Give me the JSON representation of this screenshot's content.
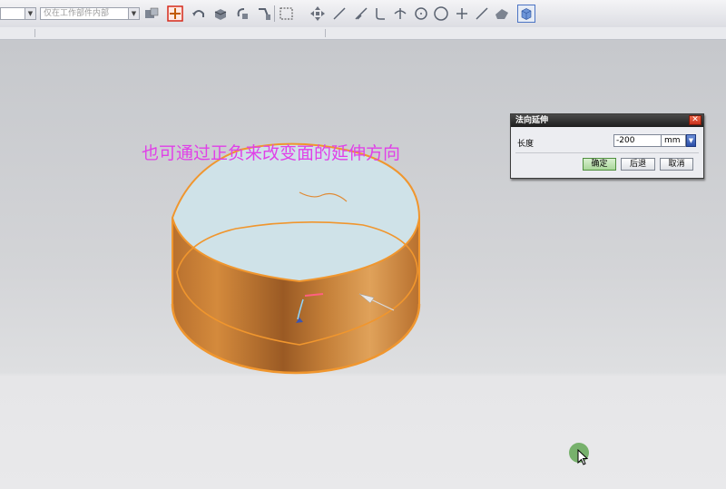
{
  "toolbar": {
    "combo_filter": "",
    "combo_scope": "仅在工作部件内部",
    "icons": [
      "filter-icon",
      "snap-point-icon",
      "undo-icon",
      "solid-box-icon",
      "rotate-icon",
      "transform-icon",
      "rectangle-select-icon",
      "move-icon",
      "line-icon",
      "dashed-line-icon",
      "curve-icon",
      "perpendicular-icon",
      "circle-icon",
      "circle-outline-icon",
      "plus-icon",
      "slash-icon",
      "shape-icon",
      "view-cube-icon"
    ]
  },
  "viewport": {
    "annotation": "也可通过正负来改变面的延伸方向",
    "annotation_color": "#e040e8",
    "model_fill": "#d98d3a",
    "model_top_fill": "#cfe2e8",
    "model_edge": "#f0962e"
  },
  "dialog": {
    "title": "法向延伸",
    "close_symbol": "✕",
    "length_label": "长度",
    "length_value": "-200",
    "unit": "mm",
    "ok_label": "确定",
    "back_label": "后退",
    "cancel_label": "取消"
  }
}
